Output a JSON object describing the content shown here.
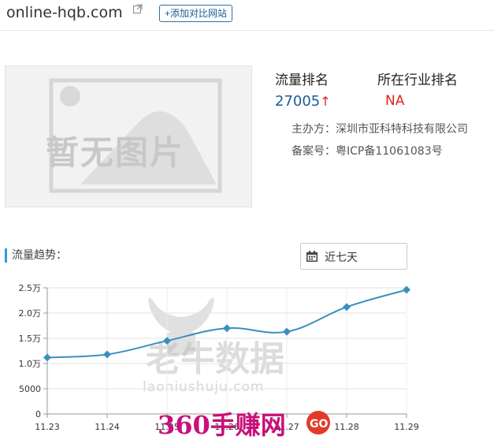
{
  "header": {
    "domain": "online-hqb.com",
    "add_compare_label": "+添加对比网站"
  },
  "thumbnail": {
    "placeholder_text": "暂无图片"
  },
  "stats": {
    "traffic_rank_label": "流量排名",
    "traffic_rank_value": "27005",
    "traffic_rank_arrow": "↑",
    "industry_rank_label": "所在行业排名",
    "industry_rank_value": "NA"
  },
  "info": {
    "sponsor_label": "主办方：",
    "sponsor_value": "深圳市亚科特科技有限公司",
    "icp_label": "备案号：",
    "icp_value": "粤ICP备11061083号"
  },
  "trend": {
    "title": "流量趋势：",
    "range_value": "近七天"
  },
  "watermarks": {
    "laoniu_text": "老牛数据",
    "laoniu_site": "laoniushuju.com",
    "brand_360": "360手赚网"
  },
  "colors": {
    "line": "#3a8fc0",
    "accent": "#2d9fd4",
    "rank": "#1a5a9a",
    "red": "#e02020"
  },
  "chart_data": {
    "type": "line",
    "categories": [
      "11.23",
      "11.24",
      "11.25",
      "11.26",
      "11.27",
      "11.28",
      "11.29"
    ],
    "values": [
      11200,
      11800,
      14500,
      17000,
      16300,
      21200,
      24600
    ],
    "ylim": [
      0,
      25000
    ],
    "yticks": [
      0,
      5000,
      10000,
      15000,
      20000,
      25000
    ],
    "ytick_labels": [
      "0",
      "5000",
      "1.0万",
      "1.5万",
      "2.0万",
      "2.5万"
    ],
    "grid": true,
    "legend": "none"
  }
}
